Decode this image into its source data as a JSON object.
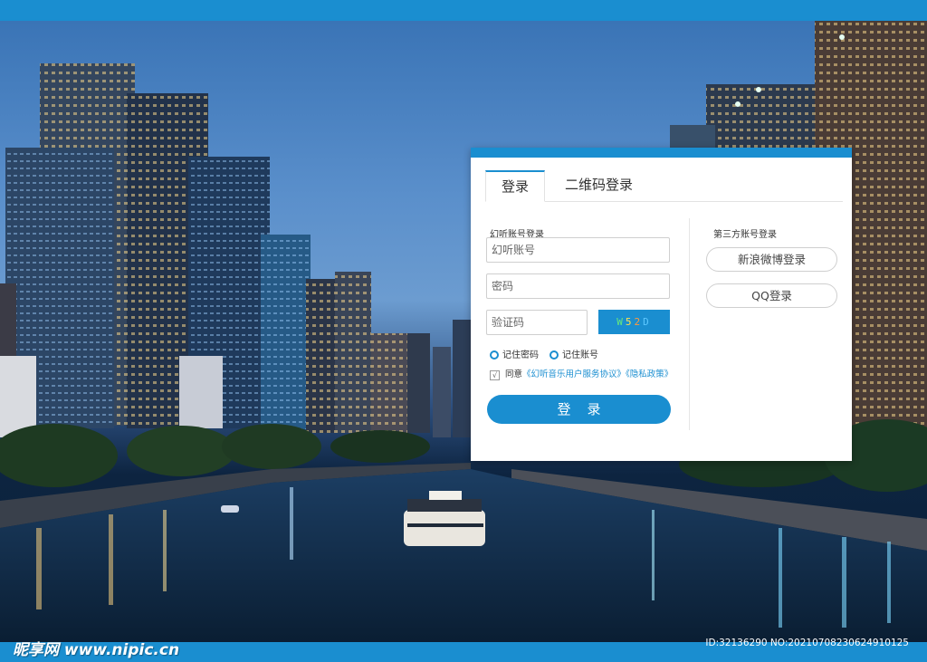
{
  "colors": {
    "accent": "#1a8ed0",
    "panel_bg": "#ffffff"
  },
  "tabs": [
    {
      "label": "登录",
      "active": true
    },
    {
      "label": "二维码登录",
      "active": false
    }
  ],
  "account_login": {
    "section_title": "幻听账号登录",
    "account_placeholder": "幻听账号",
    "password_placeholder": "密码",
    "captcha_placeholder": "验证码",
    "captcha_chars": [
      "W",
      "5",
      "2",
      "D"
    ],
    "remember_password": "记住密码",
    "remember_account": "记住账号",
    "agree_prefix": "同意",
    "agree_checked_mark": "√",
    "service_agreement": "《幻听音乐用户服务协议》",
    "privacy_policy": "《隐私政策》",
    "login_button": "登录"
  },
  "third_party": {
    "section_title": "第三方账号登录",
    "weibo_button": "新浪微博登录",
    "qq_button": "QQ登录"
  },
  "watermark": {
    "site_brand": "昵享网",
    "site_url": "www.nipic.cn",
    "image_id": "ID:32136290 NO:20210708230624910125"
  }
}
